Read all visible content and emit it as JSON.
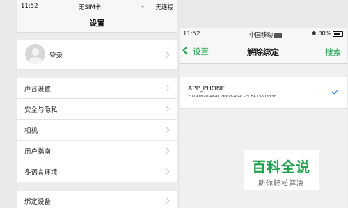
{
  "left": {
    "status": {
      "time": "11:52",
      "carrier": "无SIM卡",
      "bluetooth": "⁎",
      "wifi": "无连接"
    },
    "title": "设置",
    "login_label": "登录",
    "items": [
      {
        "label": "声音设置"
      },
      {
        "label": "安全与隐私"
      },
      {
        "label": "相机"
      },
      {
        "label": "用户指南"
      },
      {
        "label": "多语言环境"
      }
    ],
    "bind_device_label": "绑定设备"
  },
  "right": {
    "status": {
      "time": "11:52",
      "carrier": "中国移动",
      "icons": "✱ 80%"
    },
    "back_label": "设置",
    "title": "解除绑定",
    "action_label": "搜索",
    "device": {
      "name": "APP_PHONE",
      "id": "2029782D-46AC-9D63-A59C-ECBA1580333F"
    }
  },
  "watermark": {
    "main": "百科全说",
    "sub": "助你轻松解决"
  }
}
